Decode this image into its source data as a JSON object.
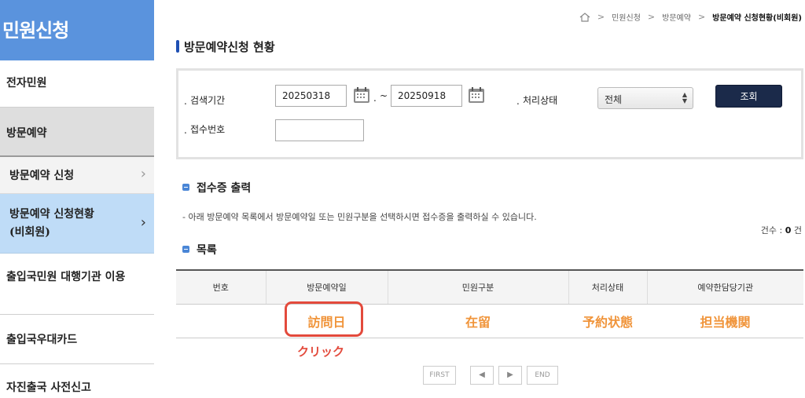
{
  "sidebar": {
    "title": "민원신청",
    "items": [
      {
        "label": "전자민원"
      },
      {
        "label": "방문예약"
      },
      {
        "label": "방문예약 신청",
        "chevron": "›"
      },
      {
        "label_line1": "방문예약 신청현황",
        "label_line2": "(비회원)",
        "chevron": "›"
      },
      {
        "label": "출입국민원 대행기관 이용"
      },
      {
        "label": "출입국우대카드"
      },
      {
        "label": "자진출국 사전신고"
      }
    ]
  },
  "breadcrumb": {
    "home_icon": "home-icon",
    "separator": ">",
    "items": [
      "민원신청",
      "방문예약",
      "방문예약 신청현황(비회원)"
    ]
  },
  "page_title": "방문예약신청 현황",
  "search": {
    "period_label": "검색기간",
    "date_from": "20250318",
    "tilde": "~",
    "date_to": "20250918",
    "status_label": "처리상태",
    "status_value": "전체",
    "receipt_label": "접수번호",
    "receipt_value": "",
    "search_button": "조회"
  },
  "print_section": {
    "title": "접수증 출력",
    "notice": "- 아래 방문예약 목록에서 방문예약일 또는 민원구분을 선택하시면 접수증을 출력하실 수 있습니다."
  },
  "count": {
    "label": "건수 : ",
    "value": "0",
    "unit": " 건"
  },
  "list_section": {
    "title": "목록"
  },
  "table": {
    "headers": [
      "번호",
      "방문예약일",
      "민원구분",
      "처리상태",
      "예약한담당기관"
    ],
    "row": [
      "",
      "訪問日",
      "在留",
      "予約状態",
      "担当機関"
    ]
  },
  "annotation": {
    "click_note": "クリック",
    "highlight_color": "#e34a3c"
  },
  "pagination": {
    "first": "FIRST",
    "prev": "◀",
    "next": "▶",
    "end": "END"
  },
  "colors": {
    "sidebar_header": "#5a93dd",
    "active_sub": "#bfdcf7",
    "button": "#1b2a4a",
    "accent_text": "#f0943a"
  }
}
